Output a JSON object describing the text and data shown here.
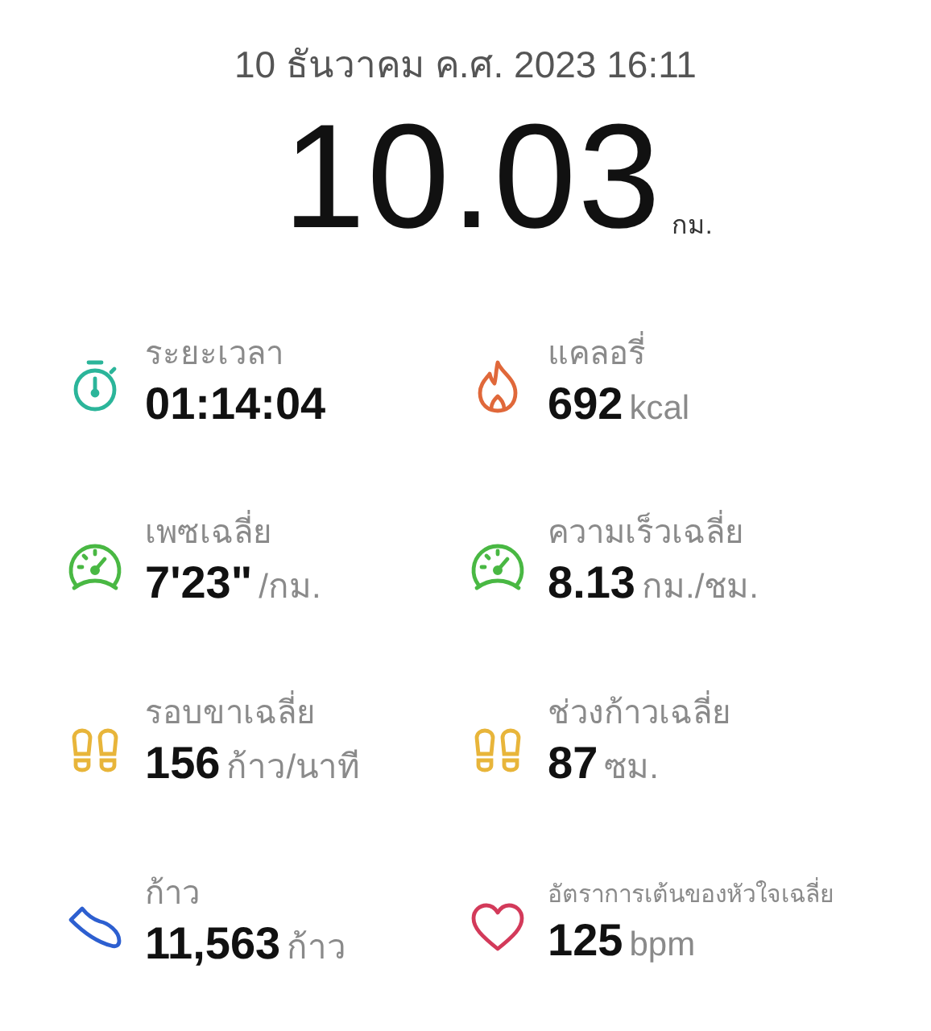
{
  "date": "10 ธันวาคม ค.ศ. 2023 16:11",
  "distance": {
    "value": "10.03",
    "unit": "กม."
  },
  "stats": [
    {
      "kind": "stopwatch",
      "label": "ระยะเวลา",
      "value": "01:14:04"
    },
    {
      "kind": "flame",
      "label": "แคลอรี่",
      "value": "692",
      "unit": "kcal"
    },
    {
      "kind": "gauge",
      "label": "เพซเฉลี่ย",
      "value": "7'23\"",
      "unit": "/กม."
    },
    {
      "kind": "gauge",
      "label": "ความเร็วเฉลี่ย",
      "value": "8.13",
      "unit": "กม./ชม."
    },
    {
      "kind": "footprints",
      "label": "รอบขาเฉลี่ย",
      "value": "156",
      "unit": "ก้าว/นาที"
    },
    {
      "kind": "footprints",
      "label": "ช่วงก้าวเฉลี่ย",
      "value": "87",
      "unit": "ซม."
    },
    {
      "kind": "shoe",
      "label": "ก้าว",
      "value": "11,563",
      "unit": "ก้าว"
    },
    {
      "kind": "heart",
      "label": "อัตราการเต้นของหัวใจเฉลี่ย",
      "value": "125",
      "unit": "bpm"
    }
  ]
}
